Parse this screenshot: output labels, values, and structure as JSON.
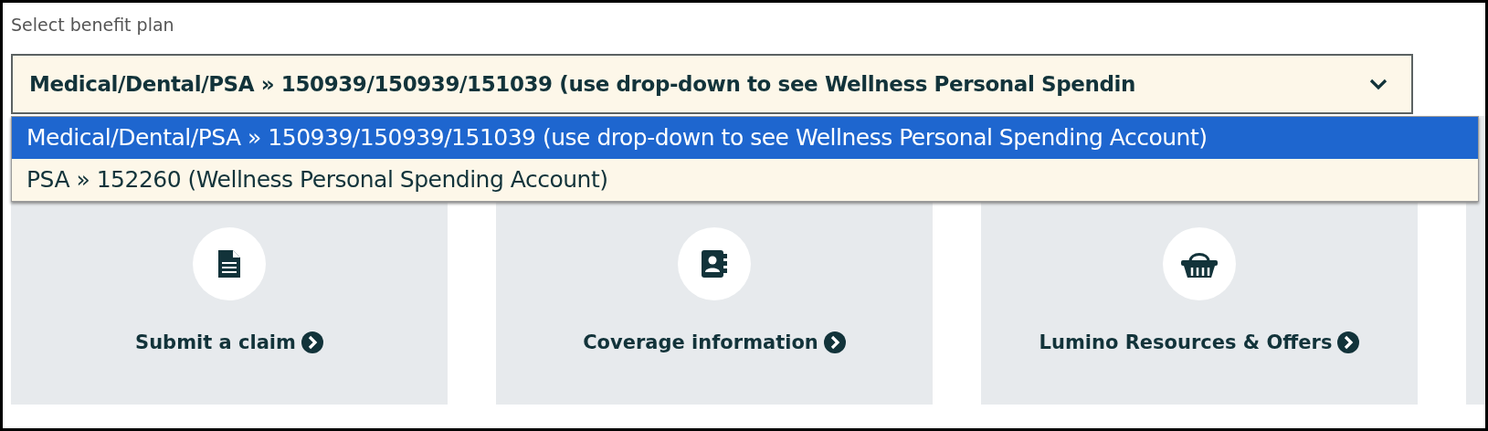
{
  "field_label": "Select benefit plan",
  "select": {
    "value": "Medical/Dental/PSA » 150939/150939/151039 (use drop-down to see Wellness Personal Spendin",
    "expanded": true
  },
  "options": [
    {
      "label": "Medical/Dental/PSA » 150939/150939/151039 (use drop-down to see Wellness Personal Spending Account)",
      "selected": true
    },
    {
      "label": "PSA » 152260 (Wellness Personal Spending Account)",
      "selected": false
    }
  ],
  "cards": [
    {
      "label": "Submit a claim",
      "kind": "document"
    },
    {
      "label": "Coverage information",
      "kind": "contact"
    },
    {
      "label": "Lumino Resources & Offers",
      "kind": "basket"
    },
    {
      "kind": "partial"
    }
  ]
}
